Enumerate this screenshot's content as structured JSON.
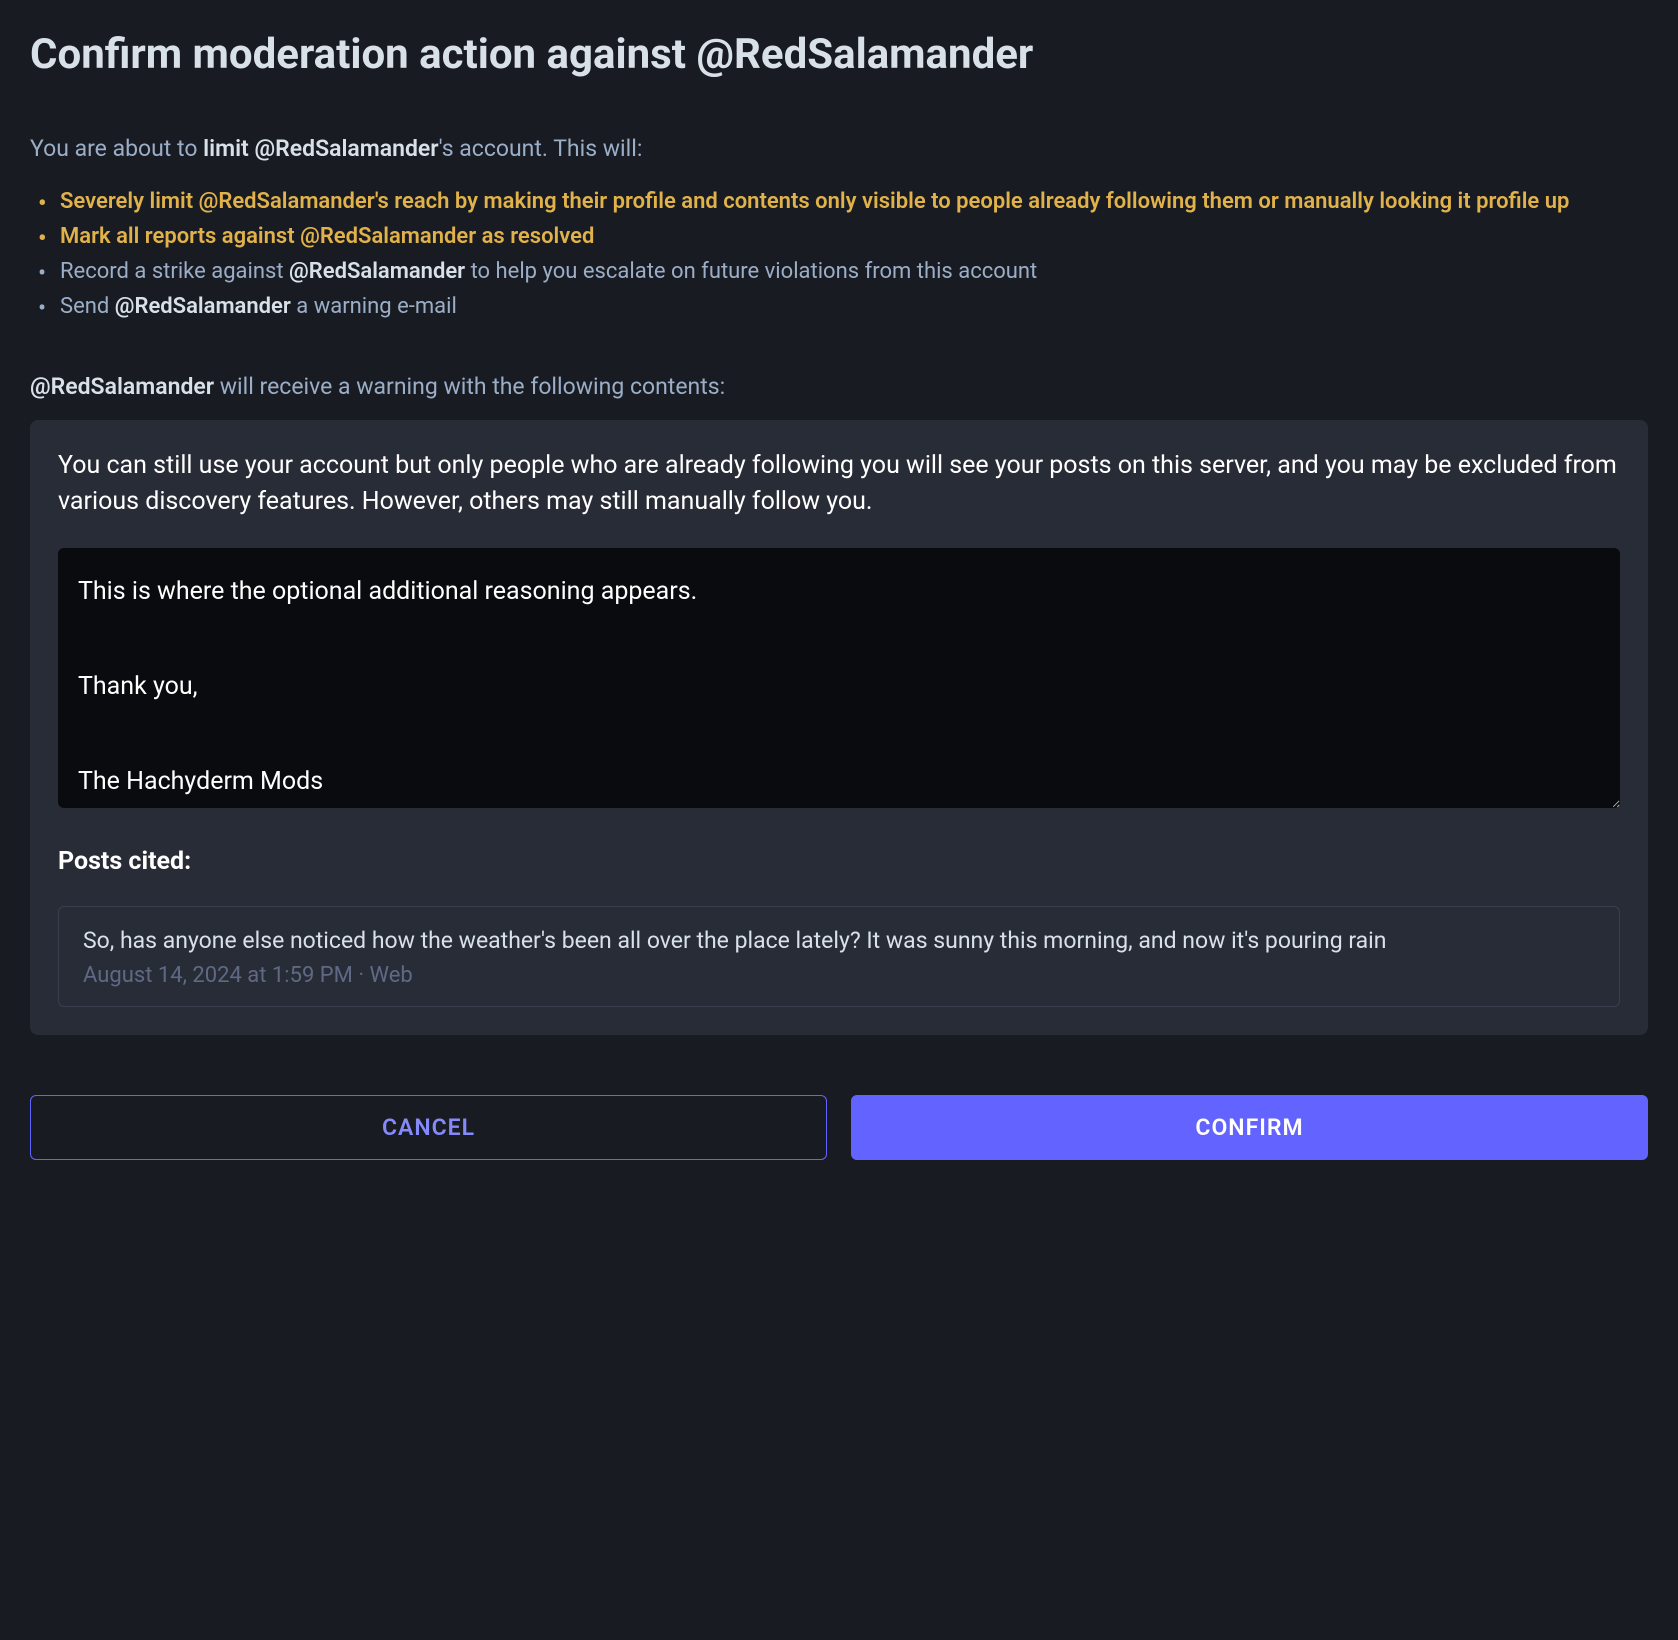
{
  "title_prefix": "Confirm moderation action against ",
  "target_handle": "@RedSalamander",
  "intro": {
    "before": "You are about to ",
    "action": "limit ",
    "suffix": "'s account. This will:"
  },
  "effects": [
    {
      "highlighted": true,
      "text": "Severely limit @RedSalamander's reach by making their profile and contents only visible to people already following them or manually looking it profile up"
    },
    {
      "highlighted": true,
      "text": "Mark all reports against @RedSalamander as resolved"
    },
    {
      "highlighted": false,
      "before": "Record a strike against ",
      "bold": "@RedSalamander",
      "after": " to help you escalate on future violations from this account"
    },
    {
      "highlighted": false,
      "before": "Send ",
      "bold": "@RedSalamander",
      "after": " a warning e-mail"
    }
  ],
  "warning_intro_suffix": " will receive a warning with the following contents:",
  "warning_description": "You can still use your account but only people who are already following you will see your posts on this server, and you may be excluded from various discovery features. However, others may still manually follow you.",
  "reasoning_text": "This is where the optional additional reasoning appears.\n\nThank you,\n\nThe Hachyderm Mods",
  "posts_cited_heading": "Posts cited:",
  "cited_posts": [
    {
      "content": "So, has anyone else noticed how the weather's been all over the place lately? It was sunny this morning, and now it's pouring rain",
      "meta": "August 14, 2024 at 1:59 PM · Web"
    }
  ],
  "buttons": {
    "cancel": "CANCEL",
    "confirm": "CONFIRM"
  }
}
